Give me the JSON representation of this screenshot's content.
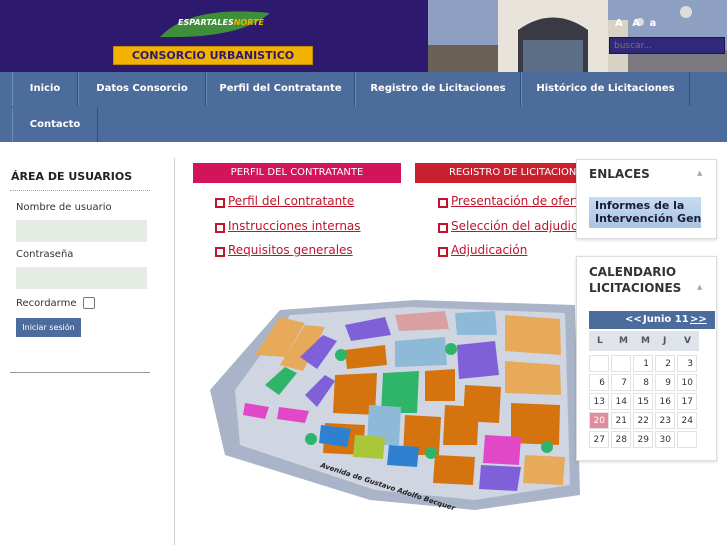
{
  "header": {
    "logo_name": "ESPARTALES",
    "logo_suffix": "NORTE",
    "banner": "CONSORCIO URBANISTICO",
    "font_tools": "A A a",
    "search_placeholder": "buscar...",
    "colors": {
      "header_bg": "#2d1a6e",
      "banner_bg": "#f1b300",
      "nav_bg": "#4c6d9c"
    }
  },
  "nav": {
    "items": [
      "Inicio",
      "Datos Consorcio",
      "Perfil del Contratante",
      "Registro de Licitaciones",
      "Histórico de Licitaciones",
      "Contacto"
    ]
  },
  "login": {
    "title": "ÁREA DE USUARIOS",
    "username_label": "Nombre de usuario",
    "password_label": "Contraseña",
    "remember_label": "Recordarme",
    "submit_label": "Iniciar sesión"
  },
  "perfil": {
    "heading": "PERFIL DEL CONTRATANTE",
    "links": [
      "Perfil del contratante",
      "Instrucciones internas",
      "Requisitos generales"
    ],
    "color": "#d2145a"
  },
  "registro": {
    "heading": "REGISTRO DE LICITACIONES",
    "links": [
      "Presentación de ofertas",
      "Selección del adjudicatario",
      "Adjudicación"
    ],
    "color": "#c8202e"
  },
  "map": {
    "street_label": "Avenida de Gustavo Adolfo Becquer"
  },
  "enlaces": {
    "title": "ENLACES",
    "link_line1": "Informes de la",
    "link_line2": "Intervención General"
  },
  "calendario": {
    "title_line1": "CALENDARIO",
    "title_line2": "LICITACIONES",
    "prev": "<<",
    "month": "Junio 11",
    "next": ">>",
    "weekdays": [
      "L",
      "M",
      "M",
      "J",
      "V"
    ],
    "weeks": [
      [
        "",
        "",
        "1",
        "2",
        "3"
      ],
      [
        "6",
        "7",
        "8",
        "9",
        "10"
      ],
      [
        "13",
        "14",
        "15",
        "16",
        "17"
      ],
      [
        "20",
        "21",
        "22",
        "23",
        "24"
      ],
      [
        "27",
        "28",
        "29",
        "30",
        ""
      ]
    ],
    "today": "20"
  }
}
